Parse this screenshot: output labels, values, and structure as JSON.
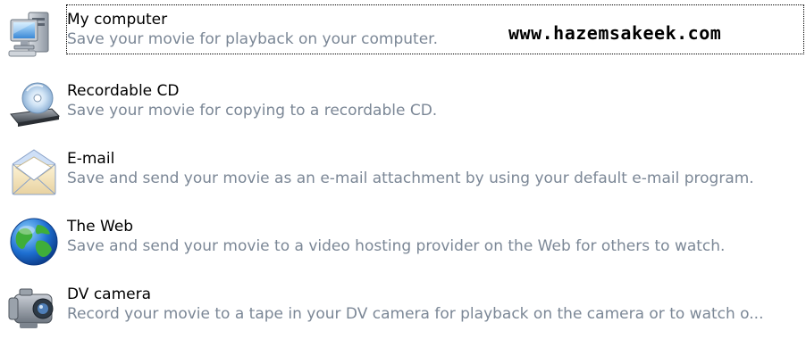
{
  "options": [
    {
      "title": "My computer",
      "description": "Save your movie for playback on your computer.",
      "icon": "computer-icon",
      "selected": true
    },
    {
      "title": "Recordable CD",
      "description": "Save your movie for copying to a recordable CD.",
      "icon": "cd-drive-icon",
      "selected": false
    },
    {
      "title": "E-mail",
      "description": "Save and send your movie as an e-mail attachment by using your default e-mail program.",
      "icon": "envelope-icon",
      "selected": false
    },
    {
      "title": "The Web",
      "description": "Save and send your movie to a video hosting provider on the Web for others to watch.",
      "icon": "globe-icon",
      "selected": false
    },
    {
      "title": "DV camera",
      "description": "Record your movie to a tape in your DV camera for playback on the camera or to watch o...",
      "icon": "camcorder-icon",
      "selected": false
    }
  ],
  "watermark": "www.hazemsakeek.com",
  "colors": {
    "title_text": "#000000",
    "description_text": "#7b8796",
    "focus_border": "#000000",
    "background": "#ffffff"
  }
}
